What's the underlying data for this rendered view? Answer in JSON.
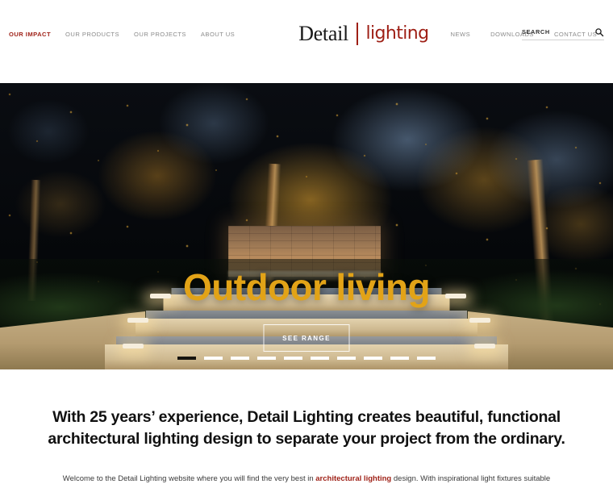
{
  "site": {
    "brand_red": "#9e1f15",
    "hero_gold": "#e2a317"
  },
  "header": {
    "nav_left": [
      {
        "label": "OUR IMPACT",
        "active": true
      },
      {
        "label": "OUR PRODUCTS",
        "active": false
      },
      {
        "label": "OUR PROJECTS",
        "active": false
      },
      {
        "label": "ABOUT US",
        "active": false
      }
    ],
    "logo": {
      "primary": "Detail",
      "secondary": "lighting"
    },
    "nav_right": [
      {
        "label": "NEWS"
      },
      {
        "label": "DOWNLOADS"
      },
      {
        "label": "CONTACT US"
      }
    ],
    "search": {
      "placeholder": "SEARCH",
      "value": "",
      "icon": "search-icon"
    }
  },
  "hero": {
    "title": "Outdoor living",
    "cta_label": "SEE RANGE",
    "slides": {
      "count": 10,
      "active_index": 0
    }
  },
  "intro": {
    "heading": "With 25 years’ experience, Detail Lighting creates beautiful, functional architectural lighting design to separate your project from the ordinary.",
    "body_before": "Welcome to the Detail Lighting website where you will find the very best in ",
    "body_link": "architectural lighting",
    "body_after": " design. With inspirational light fixtures suitable"
  }
}
